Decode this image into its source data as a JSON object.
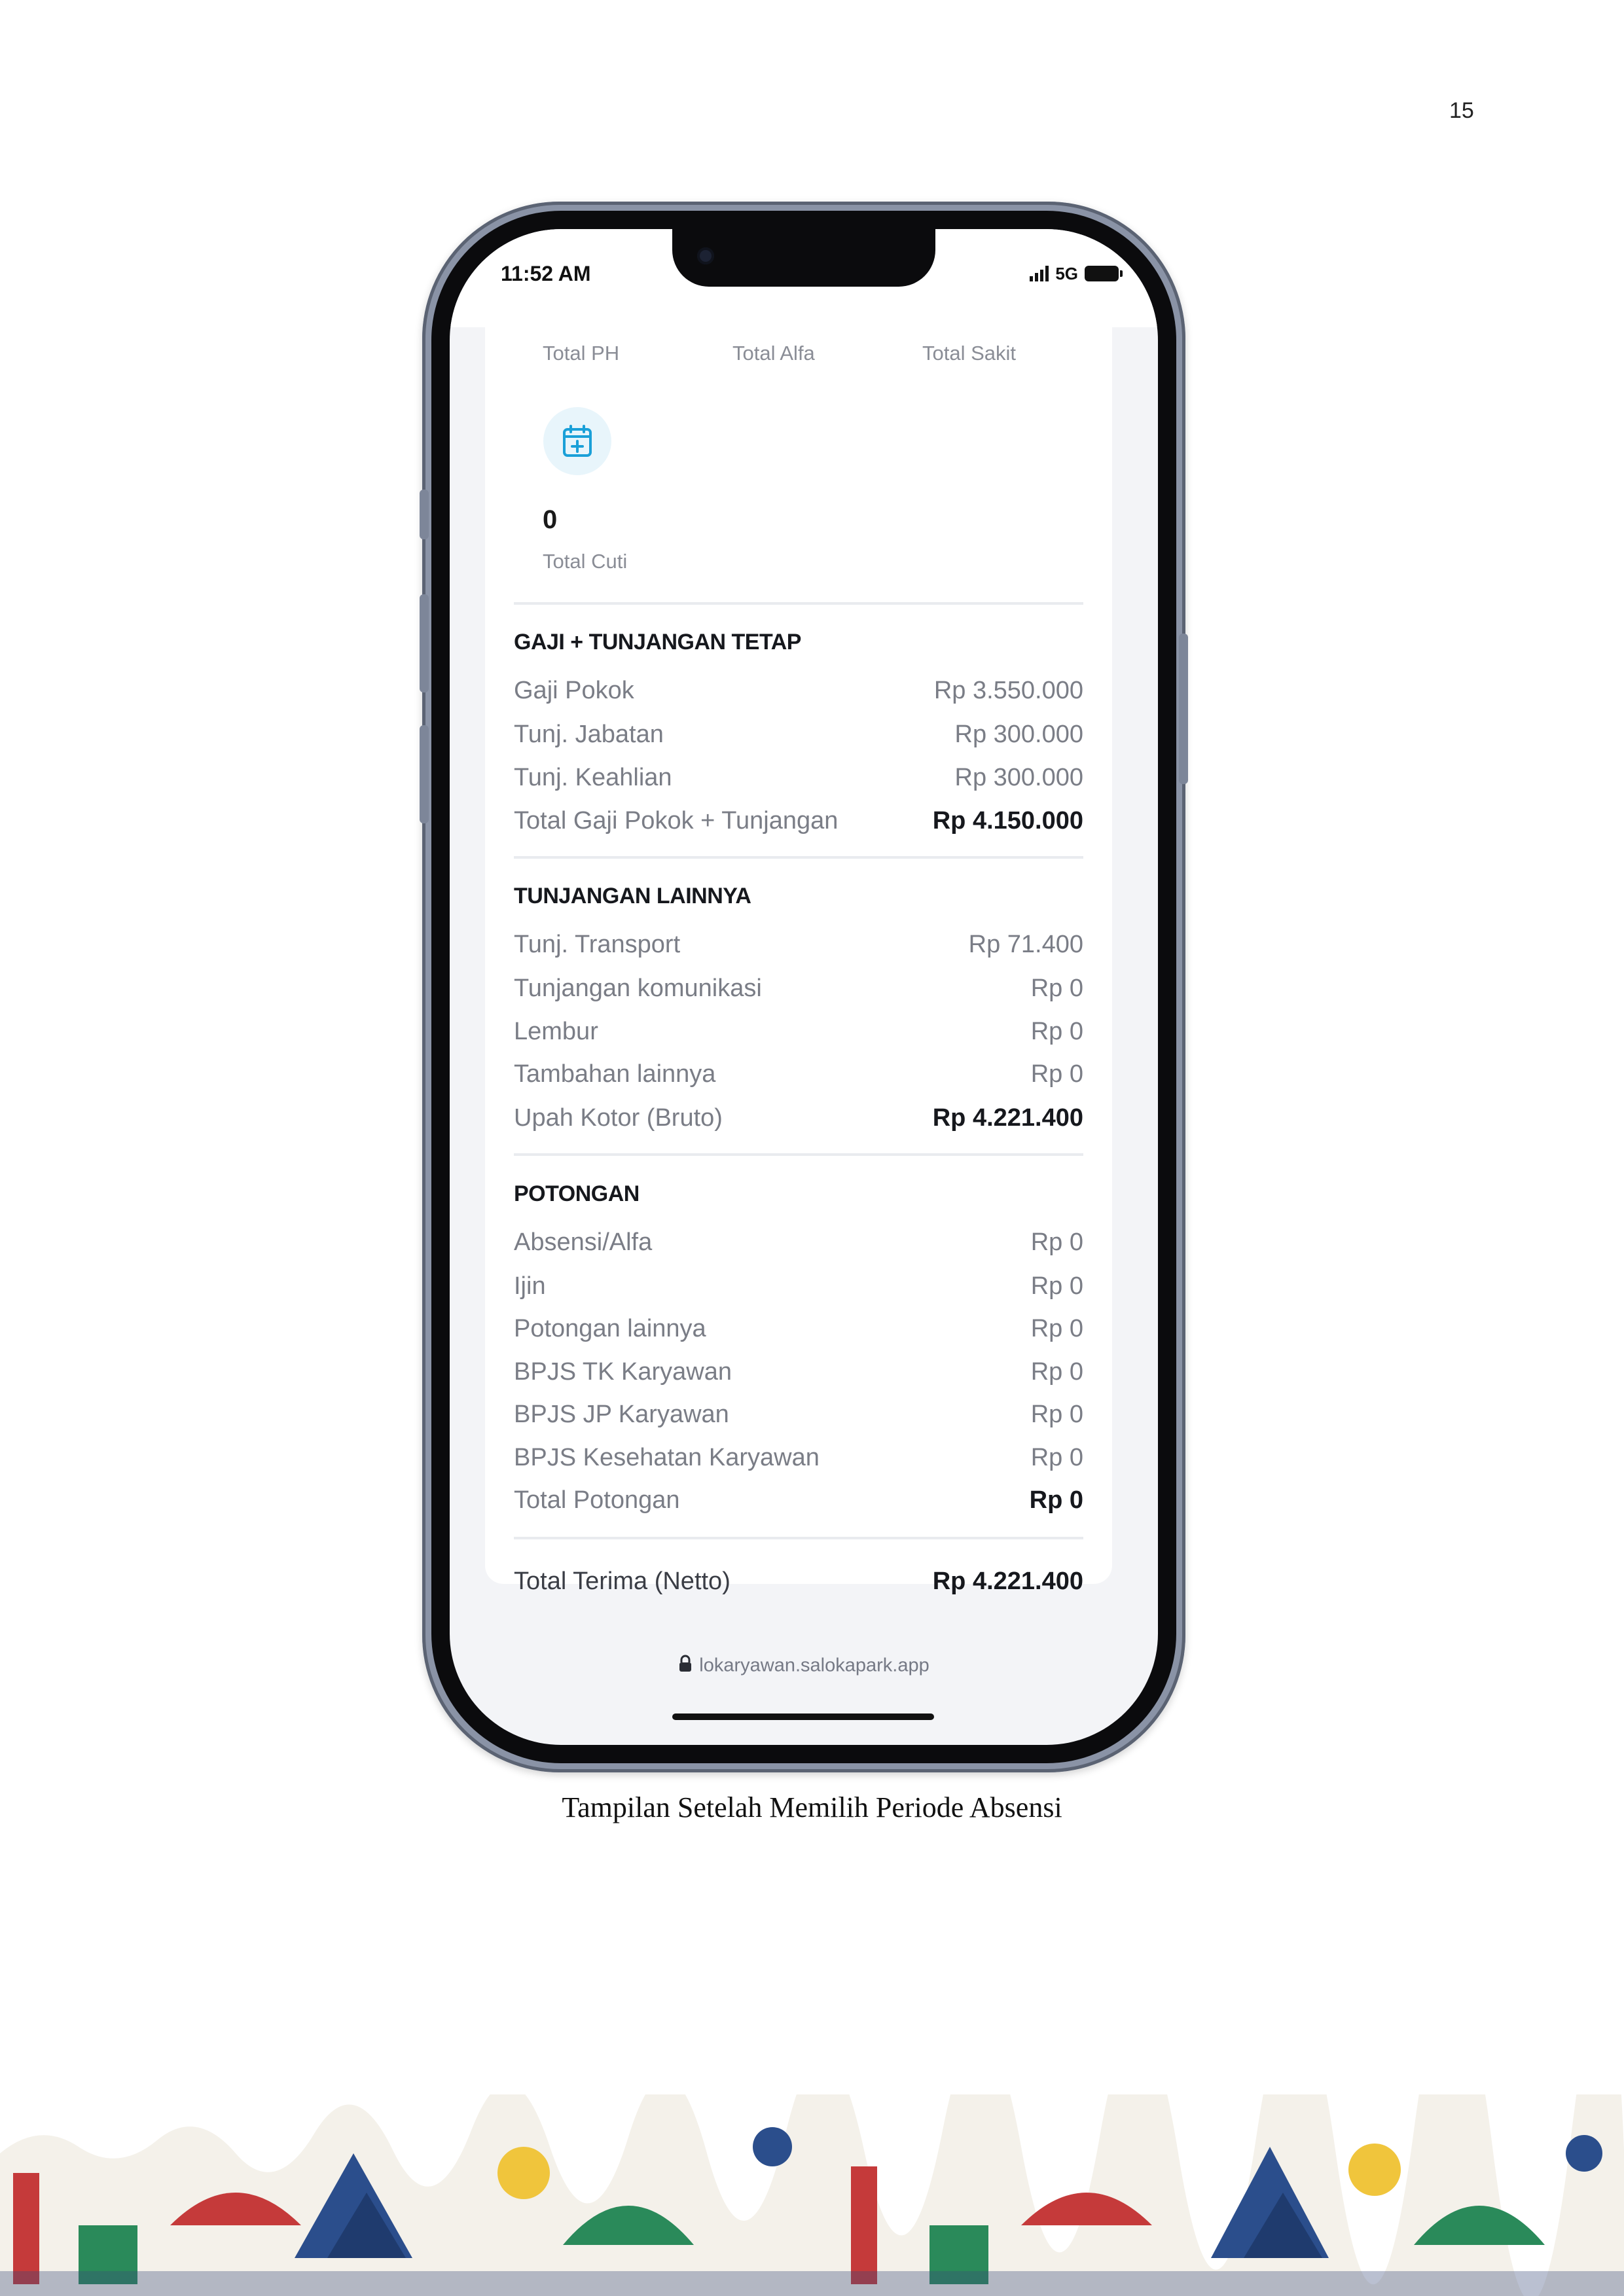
{
  "page_number": "15",
  "status_bar": {
    "time": "11:52 AM",
    "network": "5G"
  },
  "summary": {
    "labels": [
      "Total PH",
      "Total Alfa",
      "Total Sakit"
    ],
    "cuti_value": "0",
    "cuti_label": "Total Cuti"
  },
  "sections": {
    "gaji": {
      "title": "GAJI + TUNJANGAN TETAP",
      "rows": [
        {
          "label": "Gaji Pokok",
          "value": "Rp 3.550.000"
        },
        {
          "label": "Tunj. Jabatan",
          "value": "Rp 300.000"
        },
        {
          "label": "Tunj. Keahlian",
          "value": "Rp 300.000"
        },
        {
          "label": "Total Gaji Pokok + Tunjangan",
          "value": "Rp 4.150.000"
        }
      ]
    },
    "tunjangan_lainnya": {
      "title": "TUNJANGAN LAINNYA",
      "rows": [
        {
          "label": "Tunj. Transport",
          "value": "Rp 71.400"
        },
        {
          "label": "Tunjangan komunikasi",
          "value": "Rp 0"
        },
        {
          "label": "Lembur",
          "value": "Rp 0"
        },
        {
          "label": "Tambahan lainnya",
          "value": "Rp 0"
        },
        {
          "label": "Upah Kotor (Bruto)",
          "value": "Rp 4.221.400"
        }
      ]
    },
    "potongan": {
      "title": "POTONGAN",
      "rows": [
        {
          "label": "Absensi/Alfa",
          "value": "Rp 0"
        },
        {
          "label": "Ijin",
          "value": "Rp 0"
        },
        {
          "label": "Potongan lainnya",
          "value": "Rp 0"
        },
        {
          "label": "BPJS TK Karyawan",
          "value": "Rp 0"
        },
        {
          "label": "BPJS JP Karyawan",
          "value": "Rp 0"
        },
        {
          "label": "BPJS Kesehatan Karyawan",
          "value": "Rp 0"
        },
        {
          "label": "Total Potongan",
          "value": "Rp 0"
        }
      ]
    },
    "netto": {
      "label": "Total Terima (Netto)",
      "value": "Rp 4.221.400"
    }
  },
  "url": "lokaryawan.salokapark.app",
  "caption": "Tampilan Setelah Memilih Periode Absensi",
  "colors": {
    "accent": "#1aa0d8",
    "accent_bg": "#e8f5fb"
  }
}
